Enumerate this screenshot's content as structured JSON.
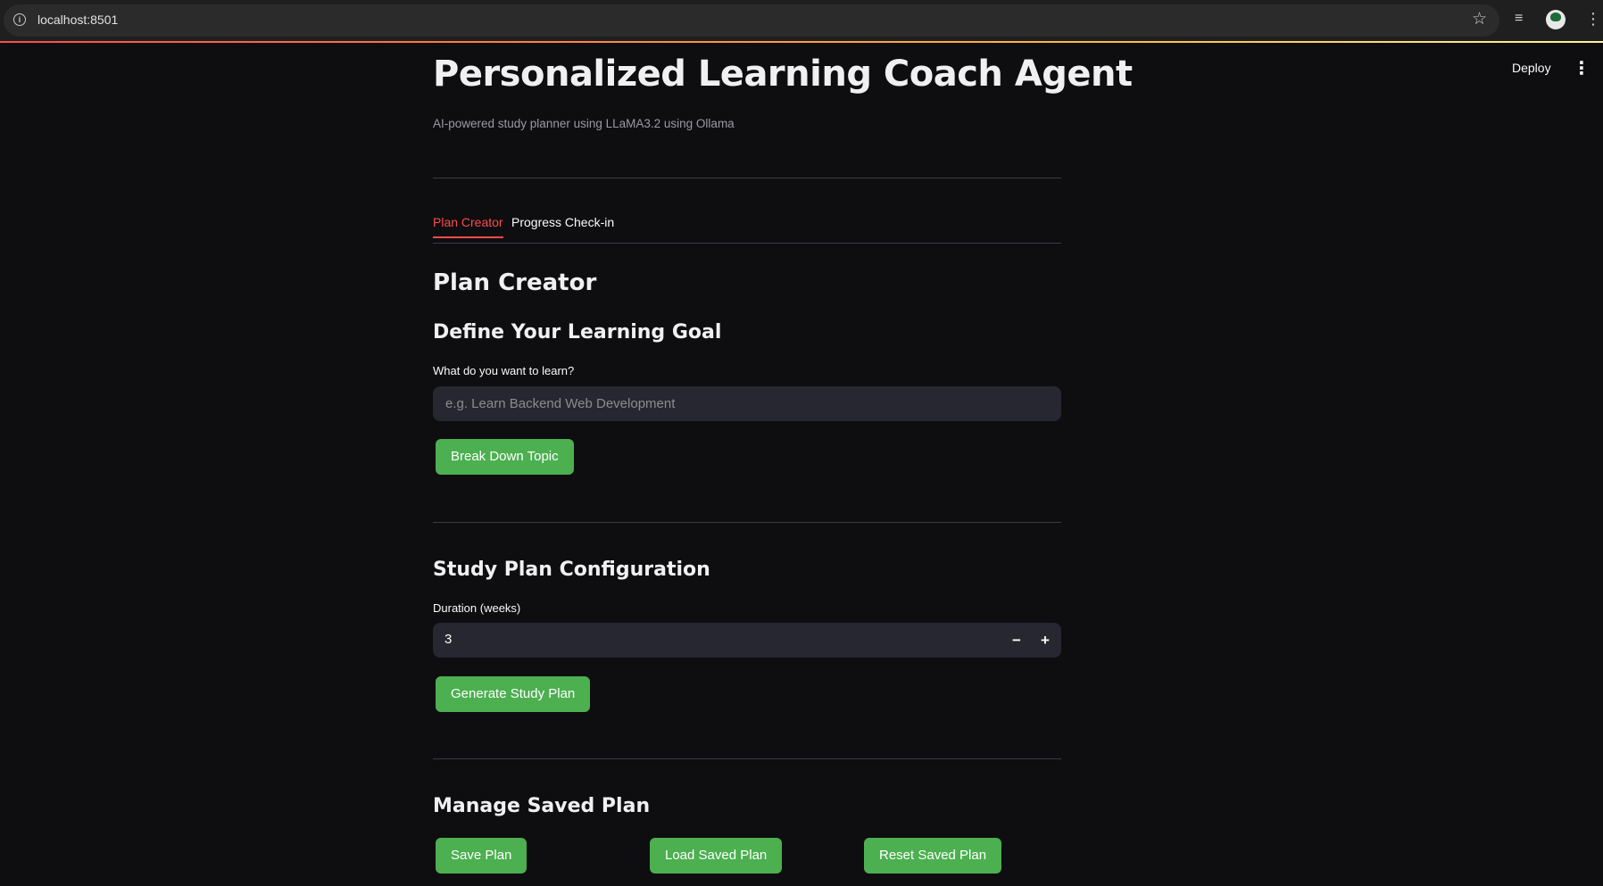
{
  "browser": {
    "url": "localhost:8501",
    "icons": [
      "info-icon",
      "star-icon",
      "media-queue-icon",
      "profile-avatar",
      "browser-menu-icon"
    ]
  },
  "toolbar": {
    "deploy_label": "Deploy",
    "menu_icon": "vertical-dots-icon"
  },
  "header": {
    "title": "Personalized Learning Coach Agent",
    "subtitle": "AI-powered study planner using LLaMA3.2 using Ollama"
  },
  "tabs": [
    {
      "label": "Plan Creator",
      "active": true
    },
    {
      "label": "Progress Check-in",
      "active": false
    }
  ],
  "plan_creator": {
    "heading": "Plan Creator",
    "goal_section": {
      "heading": "Define Your Learning Goal",
      "input_label": "What do you want to learn?",
      "input_value": "",
      "input_placeholder": "e.g. Learn Backend Web Development",
      "button_label": "Break Down Topic"
    },
    "config_section": {
      "heading": "Study Plan Configuration",
      "duration_label": "Duration (weeks)",
      "duration_value": "3",
      "decrement_symbol": "−",
      "increment_symbol": "+",
      "button_label": "Generate Study Plan"
    },
    "manage_section": {
      "heading": "Manage Saved Plan",
      "save_label": "Save Plan",
      "load_label": "Load Saved Plan",
      "reset_label": "Reset Saved Plan"
    }
  },
  "colors": {
    "accent": "#ff4b4b",
    "button_green": "#4caf50",
    "background": "#0e0e10",
    "input_bg": "#262730"
  }
}
